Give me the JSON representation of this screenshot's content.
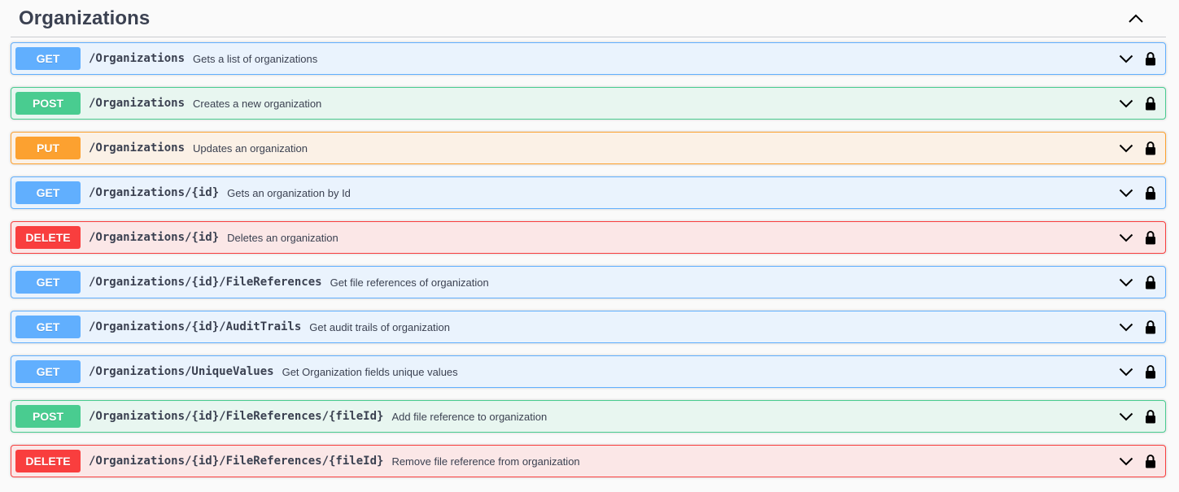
{
  "section": {
    "title": "Organizations",
    "collapse_icon": "chevron-up-icon"
  },
  "colors": {
    "get": "#61affe",
    "post": "#49cc90",
    "put": "#fca130",
    "delete": "#f93e3e"
  },
  "operations": [
    {
      "method": "GET",
      "path": "/Organizations",
      "summary": "Gets a list of organizations"
    },
    {
      "method": "POST",
      "path": "/Organizations",
      "summary": "Creates a new organization"
    },
    {
      "method": "PUT",
      "path": "/Organizations",
      "summary": "Updates an organization"
    },
    {
      "method": "GET",
      "path": "/Organizations/{id}",
      "summary": "Gets an organization by Id"
    },
    {
      "method": "DELETE",
      "path": "/Organizations/{id}",
      "summary": "Deletes an organization"
    },
    {
      "method": "GET",
      "path": "/Organizations/{id}/FileReferences",
      "summary": "Get file references of organization"
    },
    {
      "method": "GET",
      "path": "/Organizations/{id}/AuditTrails",
      "summary": "Get audit trails of organization"
    },
    {
      "method": "GET",
      "path": "/Organizations/UniqueValues",
      "summary": "Get Organization fields unique values"
    },
    {
      "method": "POST",
      "path": "/Organizations/{id}/FileReferences/{fileId}",
      "summary": "Add file reference to organization"
    },
    {
      "method": "DELETE",
      "path": "/Organizations/{id}/FileReferences/{fileId}",
      "summary": "Remove file reference from organization"
    }
  ]
}
